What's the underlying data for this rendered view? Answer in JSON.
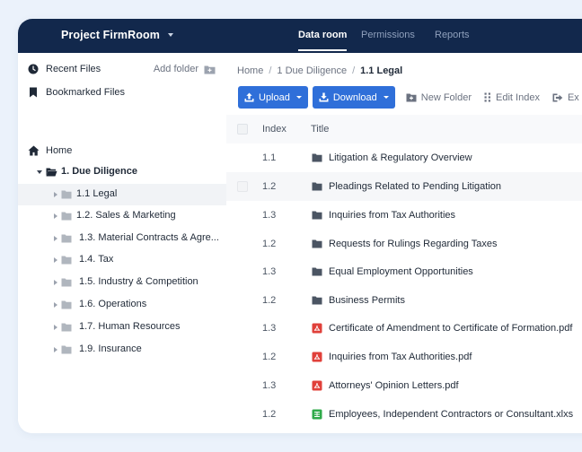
{
  "topbar": {
    "project": "Project FirmRoom",
    "tabs": [
      {
        "label": "Data room",
        "active": true
      },
      {
        "label": "Permissions",
        "active": false
      },
      {
        "label": "Reports",
        "active": false
      }
    ]
  },
  "sidebar": {
    "recent": "Recent Files",
    "add_folder": "Add folder",
    "bookmarked": "Bookmarked Files",
    "home": "Home",
    "tree": [
      {
        "label": "1. Due Diligence",
        "level": 0,
        "expanded": true,
        "selected": false
      },
      {
        "label": "1.1 Legal",
        "level": 1,
        "selected": true
      },
      {
        "label": "1.2. Sales & Marketing",
        "level": 1,
        "selected": false
      },
      {
        "label": "1.3. Material Contracts & Agre...",
        "level": 1,
        "selected": false
      },
      {
        "label": "1.4. Tax",
        "level": 1,
        "selected": false
      },
      {
        "label": "1.5. Industry & Competition",
        "level": 1,
        "selected": false
      },
      {
        "label": "1.6. Operations",
        "level": 1,
        "selected": false
      },
      {
        "label": "1.7. Human Resources",
        "level": 1,
        "selected": false
      },
      {
        "label": "1.9. Insurance",
        "level": 1,
        "selected": false
      }
    ]
  },
  "breadcrumb": [
    "Home",
    "1 Due Diligence",
    "1.1 Legal"
  ],
  "toolbar": {
    "upload": "Upload",
    "download": "Download",
    "new_folder": "New Folder",
    "edit_index": "Edit Index",
    "export": "Ex"
  },
  "table": {
    "headers": {
      "index": "Index",
      "title": "Title"
    },
    "rows": [
      {
        "index": "1.1",
        "title": "Litigation & Regulatory Overview",
        "type": "folder"
      },
      {
        "index": "1.2",
        "title": "Pleadings Related to Pending Litigation",
        "type": "folder"
      },
      {
        "index": "1.3",
        "title": "Inquiries from Tax Authorities",
        "type": "folder"
      },
      {
        "index": "1.2",
        "title": "Requests for Rulings Regarding Taxes",
        "type": "folder"
      },
      {
        "index": "1.3",
        "title": "Equal Employment Opportunities",
        "type": "folder"
      },
      {
        "index": "1.2",
        "title": "Business Permits",
        "type": "folder"
      },
      {
        "index": "1.3",
        "title": "Certificate of Amendment to Certificate of Formation.pdf",
        "type": "pdf"
      },
      {
        "index": "1.2",
        "title": "Inquiries from Tax Authorities.pdf",
        "type": "pdf"
      },
      {
        "index": "1.3",
        "title": "Attorneys' Opinion Letters.pdf",
        "type": "pdf"
      },
      {
        "index": "1.2",
        "title": "Employees, Independent Contractors or Consultant.xlxs",
        "type": "xlsx"
      }
    ]
  },
  "colors": {
    "nav_bg": "#12284c",
    "primary": "#2f6fd9",
    "pdf": "#e0403a",
    "xlsx": "#2faa4a",
    "folder": "#4b5563"
  }
}
